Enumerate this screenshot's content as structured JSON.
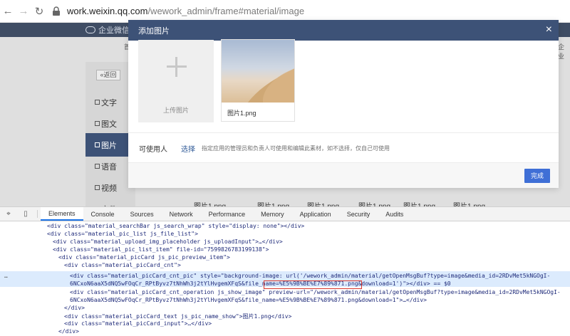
{
  "browser": {
    "url_host": "work.weixin.qq.com",
    "url_path": "/wework_admin/frame#material/image"
  },
  "app": {
    "brand": "企业微信",
    "back_label": "返回",
    "sidebar": [
      {
        "label": "文字"
      },
      {
        "label": "图文"
      },
      {
        "label": "图片",
        "active": true
      },
      {
        "label": "语音"
      },
      {
        "label": "视频"
      },
      {
        "label": "文件"
      }
    ],
    "background_captions": [
      "图片1.png",
      "图片1.png",
      "图片1.png",
      "图片1.png",
      "图片1.png",
      "图片1.png"
    ],
    "faint_texts": [
      "首",
      "企业"
    ]
  },
  "modal": {
    "title": "添加图片",
    "close_symbol": "×",
    "upload_label": "上传图片",
    "picture_name": "图片1.png",
    "permission_label": "可使用人",
    "permission_link": "选择",
    "permission_help": "指定应用的管理员和负责人可使用和编辑此素材，如不选择，仅自己可使用",
    "done_label": "完成"
  },
  "devtools": {
    "tabs": [
      "Elements",
      "Console",
      "Sources",
      "Network",
      "Performance",
      "Memory",
      "Application",
      "Security",
      "Audits"
    ],
    "active_tab": "Elements",
    "line1": "<div class=\"material_searchBar js_search_wrap\" style=\"display: none\"></div>",
    "line2": "<div class=\"material_pic_list js_file_list\">",
    "line3": "<div class=\"material_upload_img_placeholder js_uploadInput\">…</div>",
    "line4": "<div class=\"material_pic_list_item\" file-id=\"7599826783199138\">",
    "line5": "<div class=\"material_picCard js_pic_preview_item\">",
    "line6": "<div class=\"material_picCard_cnt\">",
    "line7a": "<div class=\"material_picCard_cnt_pic\" style=\"background-image: url('/wework_admin/material/getOpenMsgBuf?type=image&media_id=2RDvMet5kNGOgI-",
    "line7b": "6NCxoN6aaX5dNQ5wFOqCr_RPtByvz7tNhWh3j2tYlHvgemXFqS&file_name=%E5%9B%BE%E7%89%871.png&download=1')\"></div> == $0",
    "line8a": "<div class=\"material_picCard_cnt_operation js_show_image\" preview-url=\"/wework_admin/material/getOpenMsgBuf?type=image&media_id=2RDvMet5kNGOgI-",
    "line8b": "6NCxoN6aaX5dNQ5wFOqCr_RPtByvz7tNhWh3j2tYlHvgemXFqS&file_name=%E5%9B%BE%E7%89%871.png&download=1\">…</div>",
    "line9": "</div>",
    "line10": "<div class=\"material_picCard_text js_pic_name_show\">图片1.png</div>",
    "line11": "<div class=\"material_picCard_input\">…</div>",
    "line12": "</div>",
    "more": "…"
  }
}
